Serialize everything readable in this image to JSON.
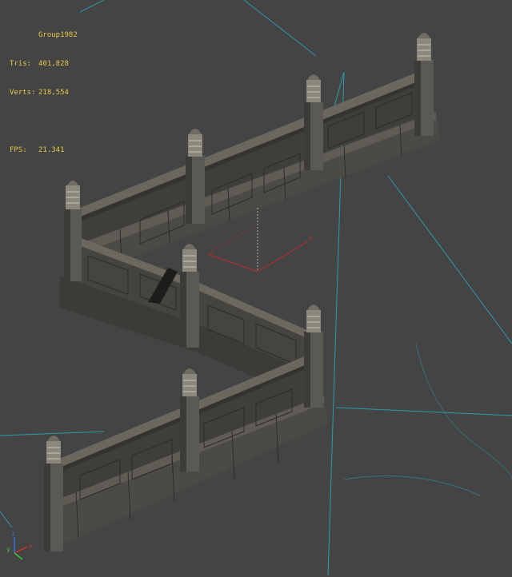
{
  "viewport": {
    "stats": {
      "object_name": "Group1982",
      "tris_label": "Tris:",
      "tris_value": "401,828",
      "verts_label": "Verts:",
      "verts_value": "218,554",
      "fps_label": "FPS:",
      "fps_value": "21.341"
    },
    "colors": {
      "background": "#444444",
      "stats_text": "#e6c84a",
      "wire_line": "#2fb4c8",
      "stone_dark": "#3a3936",
      "stone_mid": "#57554f",
      "stone_light": "#6e6b63",
      "gizmo_x": "#d23030",
      "gizmo_y": "#3cc43c",
      "gizmo_z": "#3a6fd8"
    },
    "axis_labels": {
      "x": "x",
      "y": "y",
      "z": "z"
    }
  }
}
